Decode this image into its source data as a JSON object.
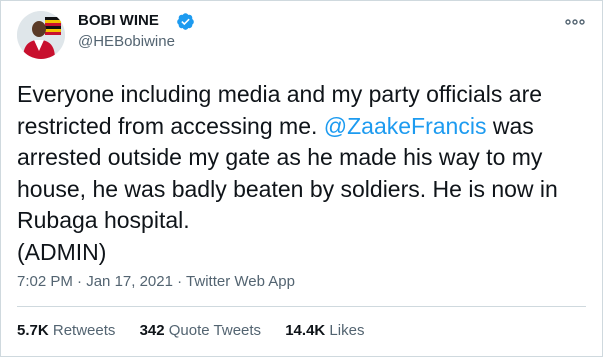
{
  "author": {
    "display_name": "BOBI WINE",
    "handle": "@HEBobiwine",
    "verified": true
  },
  "tweet": {
    "text_before": "Everyone including media and my party officials are restricted from accessing me. ",
    "mention": "@ZaakeFrancis",
    "text_after": " was arrested outside my gate as he made his way to my house, he was badly beaten by soldiers. He is now in Rubaga hospital.",
    "signoff": "(ADMIN)"
  },
  "meta": {
    "time": "7:02 PM",
    "separator": "·",
    "date": "Jan 17, 2021",
    "source": "Twitter Web App"
  },
  "stats": {
    "retweets_count": "5.7K",
    "retweets_label": "Retweets",
    "quotes_count": "342",
    "quotes_label": "Quote Tweets",
    "likes_count": "14.4K",
    "likes_label": "Likes"
  },
  "colors": {
    "accent": "#1d9bf0",
    "text": "#0f1419",
    "muted": "#536471",
    "border": "#cfd9de"
  },
  "icons": {
    "verified": "verified-badge-icon",
    "more": "more-options-icon",
    "flag": "uganda-flag-icon"
  }
}
